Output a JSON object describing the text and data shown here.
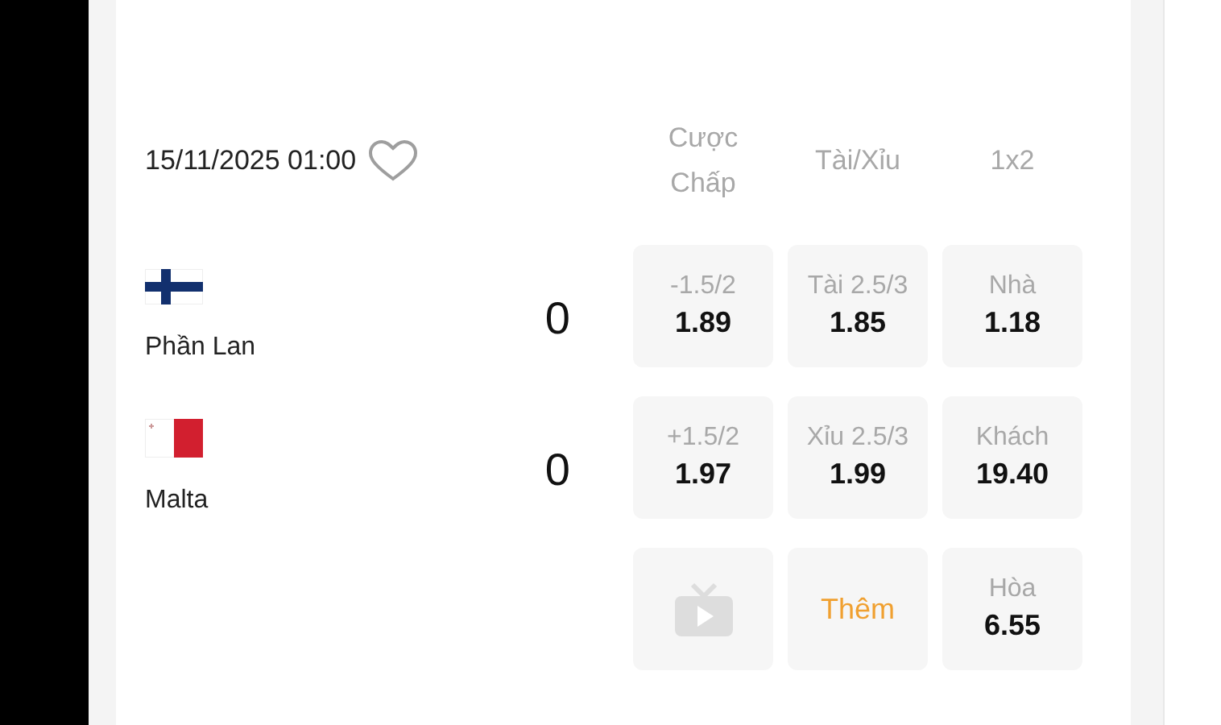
{
  "match": {
    "datetime": "15/11/2025 01:00",
    "favorite": false
  },
  "columns": [
    "Cược Chấp",
    "Tài/Xỉu",
    "1x2"
  ],
  "teams": [
    {
      "name": "Phần Lan",
      "score": "0",
      "kind": "finland"
    },
    {
      "name": "Malta",
      "score": "0",
      "kind": "malta"
    }
  ],
  "odds": [
    {
      "kind": "odd",
      "label": "-1.5/2",
      "value": "1.89"
    },
    {
      "kind": "odd",
      "label": "Tài 2.5/3",
      "value": "1.85"
    },
    {
      "kind": "odd",
      "label": "Nhà",
      "value": "1.18"
    },
    {
      "kind": "odd",
      "label": "+1.5/2",
      "value": "1.97"
    },
    {
      "kind": "odd",
      "label": "Xỉu 2.5/3",
      "value": "1.99"
    },
    {
      "kind": "odd",
      "label": "Khách",
      "value": "19.40"
    },
    {
      "kind": "tv"
    },
    {
      "kind": "more",
      "label": "Thêm"
    },
    {
      "kind": "odd",
      "label": "Hòa",
      "value": "6.55"
    }
  ]
}
